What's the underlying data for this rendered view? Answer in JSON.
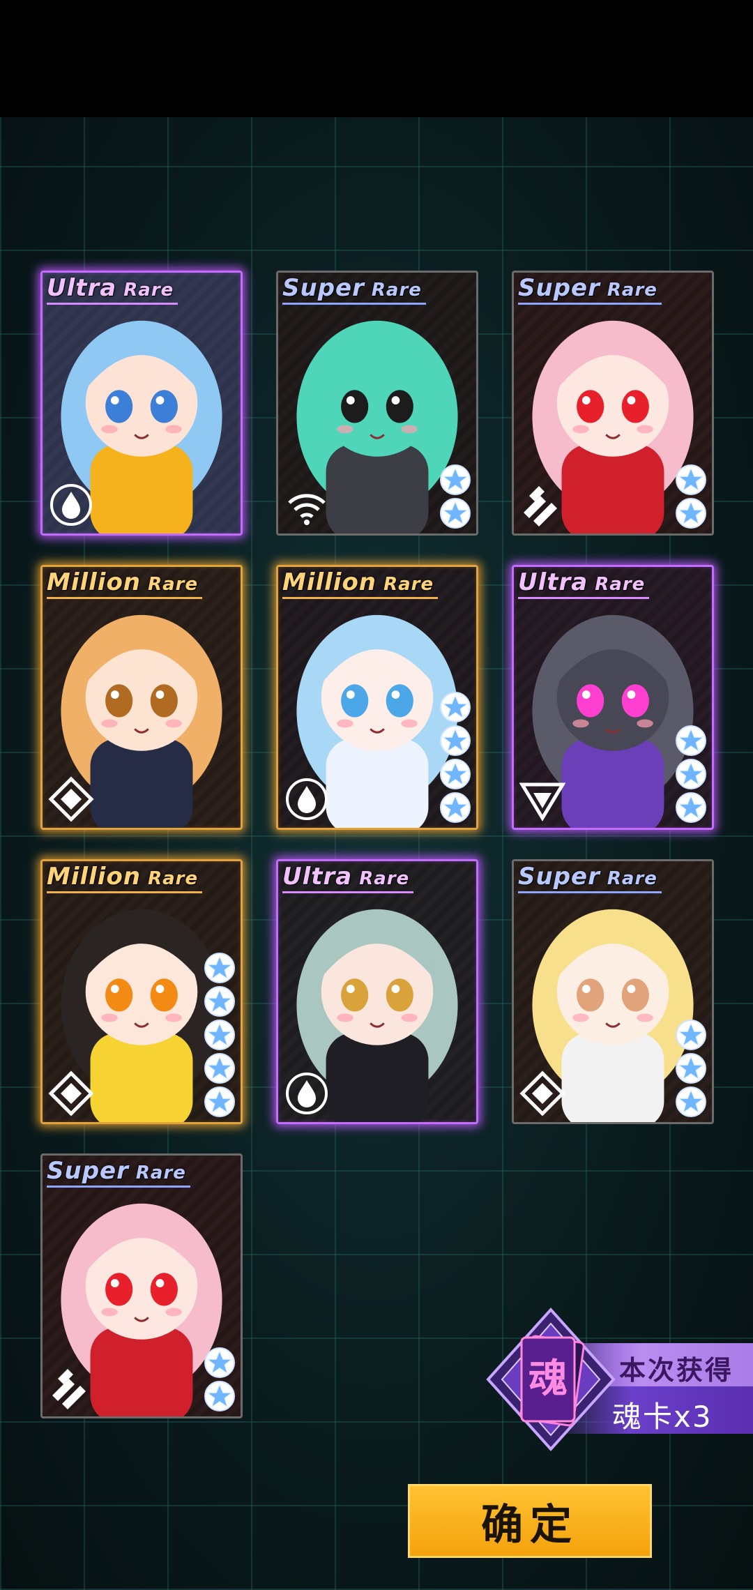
{
  "cards": [
    {
      "rarity_main": "Ultra",
      "rarity_word": "Rare",
      "tier": "ur",
      "element": "water",
      "stars": 0,
      "character": "blue-twintail-idol"
    },
    {
      "rarity_main": "Super",
      "rarity_word": "Rare",
      "tier": "sr",
      "element": "signal",
      "stars": 2,
      "character": "green-skull-mech"
    },
    {
      "rarity_main": "Super",
      "rarity_word": "Rare",
      "tier": "sr",
      "element": "stripes",
      "stars": 2,
      "character": "pink-headphone-chibi"
    },
    {
      "rarity_main": "Million",
      "rarity_word": "Rare",
      "tier": "mr",
      "element": "diamond",
      "stars": 0,
      "character": "orange-twintail-gunner"
    },
    {
      "rarity_main": "Million",
      "rarity_word": "Rare",
      "tier": "mr",
      "element": "water",
      "stars": 4,
      "character": "ice-crown-chibi"
    },
    {
      "rarity_main": "Ultra",
      "rarity_word": "Rare",
      "tier": "ur",
      "element": "triangle",
      "stars": 3,
      "character": "purple-robot"
    },
    {
      "rarity_main": "Million",
      "rarity_word": "Rare",
      "tier": "mr",
      "element": "diamond",
      "stars": 5,
      "character": "yellow-dress-chibi"
    },
    {
      "rarity_main": "Ultra",
      "rarity_word": "Rare",
      "tier": "ur",
      "element": "water",
      "stars": 0,
      "character": "silver-hair-shield"
    },
    {
      "rarity_main": "Super",
      "rarity_word": "Rare",
      "tier": "sr",
      "element": "diamond",
      "stars": 3,
      "character": "blonde-helmet-chibi"
    },
    {
      "rarity_main": "Super",
      "rarity_word": "Rare",
      "tier": "sr",
      "element": "stripes",
      "stars": 2,
      "character": "pink-headphone-chibi"
    }
  ],
  "soul": {
    "badge_char": "魂",
    "title": "本次获得",
    "count": "魂卡x3"
  },
  "confirm_label": "确定",
  "colors": {
    "ultra": "#c66bff",
    "million": "#e2a33a",
    "super": "#8fa6ff",
    "button": "#f4a20c"
  }
}
